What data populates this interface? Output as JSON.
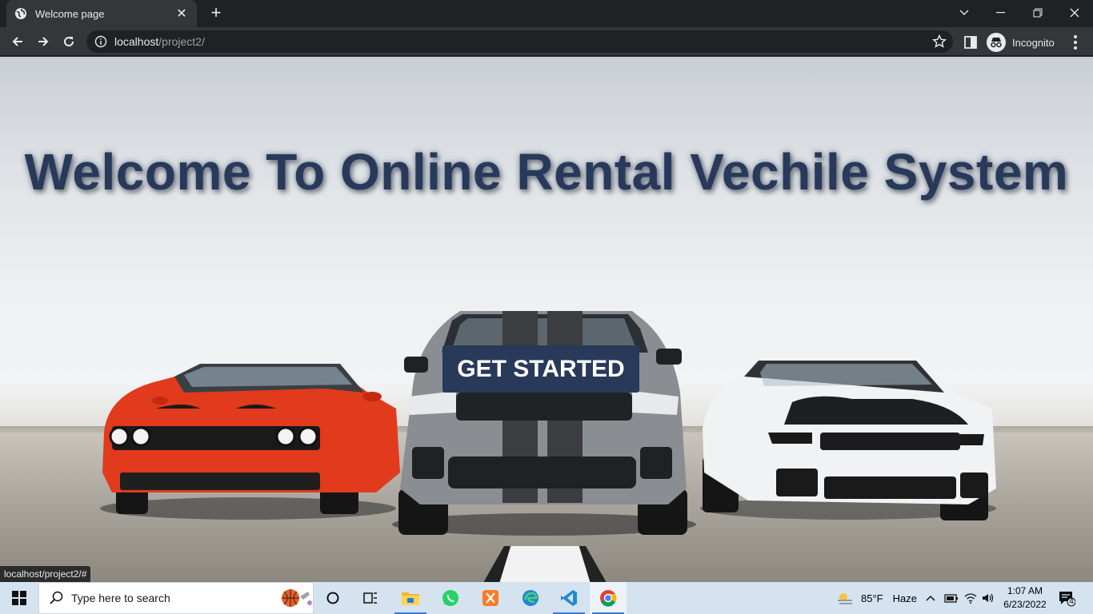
{
  "browser": {
    "tab_title": "Welcome page",
    "url_host": "localhost",
    "url_path": "/project2/",
    "profile_label": "Incognito",
    "status_url": "localhost/project2/#"
  },
  "page": {
    "heading": "Welcome To Online Rental Vechile System",
    "cta_label": "GET STARTED"
  },
  "taskbar": {
    "search_placeholder": "Type here to search",
    "weather_temp": "85°F",
    "weather_desc": "Haze",
    "time": "1:07 AM",
    "date": "6/23/2022",
    "notification_count": "4",
    "apps": [
      "task-view",
      "file-explorer",
      "whatsapp",
      "xampp",
      "edge",
      "vscode",
      "chrome"
    ]
  },
  "colors": {
    "heading": "#28395a",
    "cta_bg": "#28395a",
    "car_left": "#e23a1c",
    "car_mid": "#8a8d92",
    "car_right": "#f1f2f4"
  }
}
